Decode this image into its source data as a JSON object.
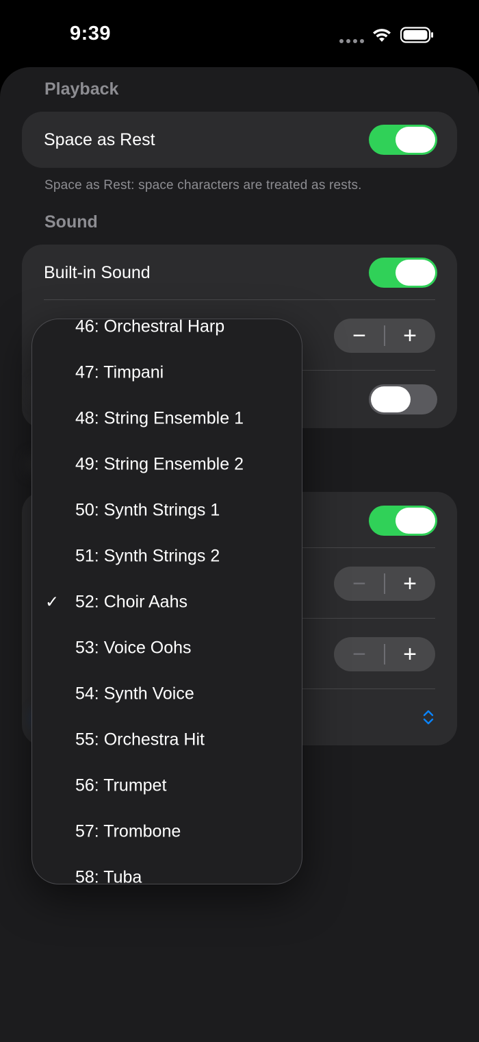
{
  "status_bar": {
    "time": "9:39"
  },
  "playback": {
    "section_title": "Playback",
    "space_as_rest": {
      "label": "Space as Rest",
      "on": true
    },
    "footer": "Space as Rest: space characters are treated as rests."
  },
  "sound": {
    "section_title": "Sound",
    "built_in_sound": {
      "label": "Built-in Sound",
      "on": true
    },
    "stepper_minus": "−",
    "stepper_plus": "+",
    "second_toggle_on": false
  },
  "lower_card": {
    "toggle_on": true,
    "stepper_1": {
      "minus": "−",
      "plus": "+"
    },
    "stepper_2": {
      "minus": "−",
      "plus": "+"
    }
  },
  "instrument_menu": {
    "items": [
      {
        "label": "46: Orchestral Harp",
        "selected": false
      },
      {
        "label": "47: Timpani",
        "selected": false
      },
      {
        "label": "48: String Ensemble 1",
        "selected": false
      },
      {
        "label": "49: String Ensemble 2",
        "selected": false
      },
      {
        "label": "50: Synth Strings 1",
        "selected": false
      },
      {
        "label": "51: Synth Strings 2",
        "selected": false
      },
      {
        "label": "52: Choir Aahs",
        "selected": true
      },
      {
        "label": "53: Voice Oohs",
        "selected": false
      },
      {
        "label": "54: Synth Voice",
        "selected": false
      },
      {
        "label": "55: Orchestra Hit",
        "selected": false
      },
      {
        "label": "56: Trumpet",
        "selected": false
      },
      {
        "label": "57: Trombone",
        "selected": false
      },
      {
        "label": "58: Tuba",
        "selected": false
      }
    ],
    "check_glyph": "✓"
  },
  "colors": {
    "toggle_on": "#30d158",
    "toggle_off": "#5a5a5e",
    "card_bg": "#2c2c2e",
    "sheet_bg": "#1c1c1e",
    "accent_blue": "#0a84ff"
  }
}
